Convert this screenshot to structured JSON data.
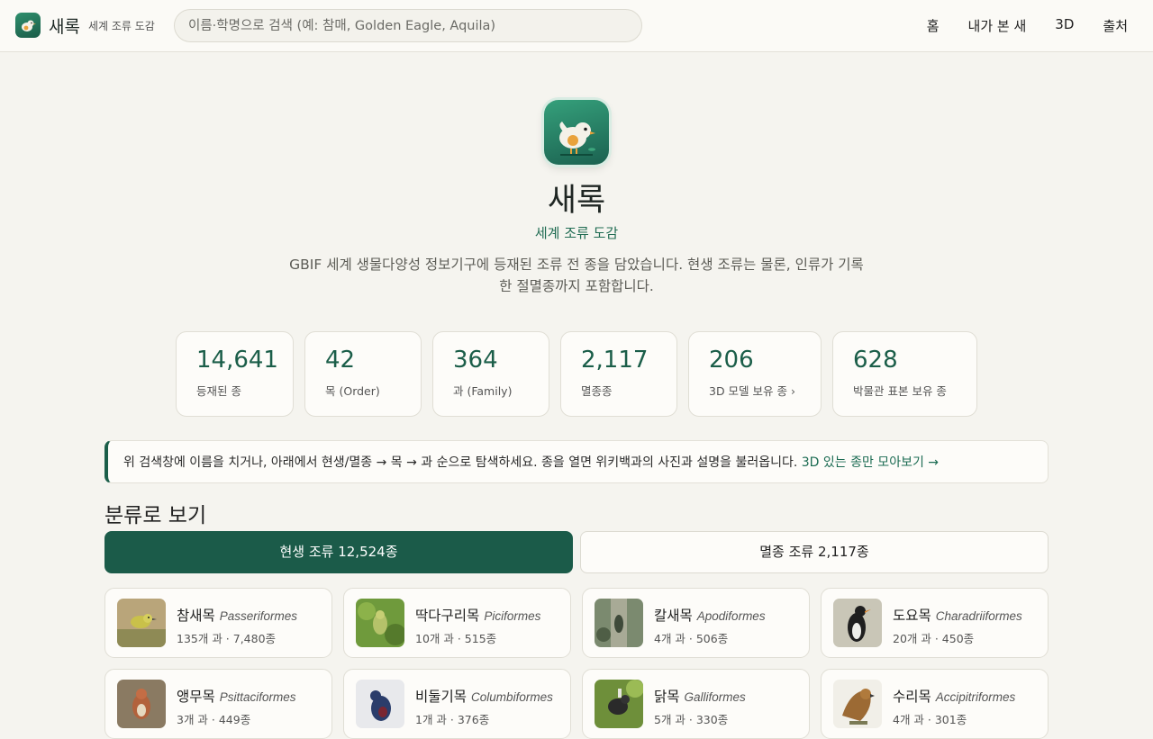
{
  "header": {
    "brand_name": "새록",
    "brand_subtitle": "세계 조류 도감",
    "search_placeholder": "이름·학명으로 검색 (예: 참매, Golden Eagle, Aquila)",
    "nav": [
      "홈",
      "내가 본 새",
      "3D",
      "출처"
    ]
  },
  "hero": {
    "title": "새록",
    "subtitle": "세계 조류 도감",
    "description": "GBIF 세계 생물다양성 정보기구에 등재된 조류 전 종을 담았습니다. 현생 조류는 물론, 인류가 기록한 절멸종까지 포함합니다."
  },
  "stats": [
    {
      "value": "14,641",
      "label": "등재된 종"
    },
    {
      "value": "42",
      "label": "목 (Order)"
    },
    {
      "value": "364",
      "label": "과 (Family)"
    },
    {
      "value": "2,117",
      "label": "멸종종"
    },
    {
      "value": "206",
      "label": "3D 모델 보유 종 ›"
    },
    {
      "value": "628",
      "label": "박물관 표본 보유 종"
    }
  ],
  "info": {
    "text": "위 검색창에 이름을 치거나, 아래에서 현생/멸종 → 목 → 과 순으로 탐색하세요. 종을 열면 위키백과의 사진과 설명을 불러옵니다. ",
    "link": "3D 있는 종만 모아보기 →"
  },
  "section_title": "분류로 보기",
  "tabs": {
    "extant": "현생 조류 12,524종",
    "extinct": "멸종 조류 2,117종"
  },
  "orders": [
    {
      "name": "참새목",
      "latin": "Passeriformes",
      "meta": "135개 과 · 7,480종"
    },
    {
      "name": "딱다구리목",
      "latin": "Piciformes",
      "meta": "10개 과 · 515종"
    },
    {
      "name": "칼새목",
      "latin": "Apodiformes",
      "meta": "4개 과 · 506종"
    },
    {
      "name": "도요목",
      "latin": "Charadriiformes",
      "meta": "20개 과 · 450종"
    },
    {
      "name": "앵무목",
      "latin": "Psittaciformes",
      "meta": "3개 과 · 449종"
    },
    {
      "name": "비둘기목",
      "latin": "Columbiformes",
      "meta": "1개 과 · 376종"
    },
    {
      "name": "닭목",
      "latin": "Galliformes",
      "meta": "5개 과 · 330종"
    },
    {
      "name": "수리목",
      "latin": "Accipitriformes",
      "meta": "4개 과 · 301종"
    }
  ],
  "colors": {
    "accent": "#1b5b49",
    "background": "#f5f4ef"
  }
}
